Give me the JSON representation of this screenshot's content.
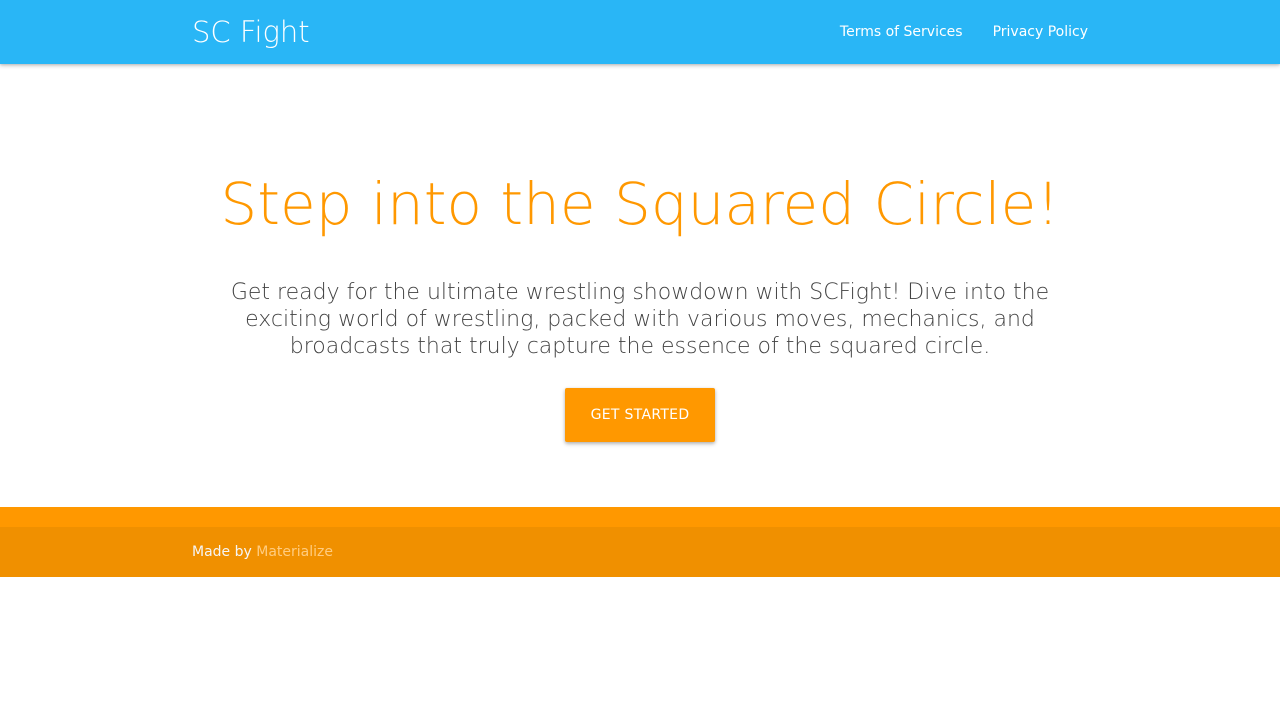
{
  "navbar": {
    "brand": "SC Fight",
    "links": [
      {
        "label": "Terms of Services"
      },
      {
        "label": "Privacy Policy"
      }
    ]
  },
  "hero": {
    "title": "Step into the Squared Circle!",
    "description": "Get ready for the ultimate wrestling showdown with SCFight! Dive into the exciting world of wrestling, packed with various moves, mechanics, and broadcasts that truly capture the essence of the squared circle.",
    "cta_label": "GET STARTED"
  },
  "footer": {
    "prefix": "Made by",
    "link_label": "Materialize"
  },
  "colors": {
    "navbar": "#29b6f6",
    "accent": "#ff9800",
    "footer_copyright": "#f09000"
  }
}
